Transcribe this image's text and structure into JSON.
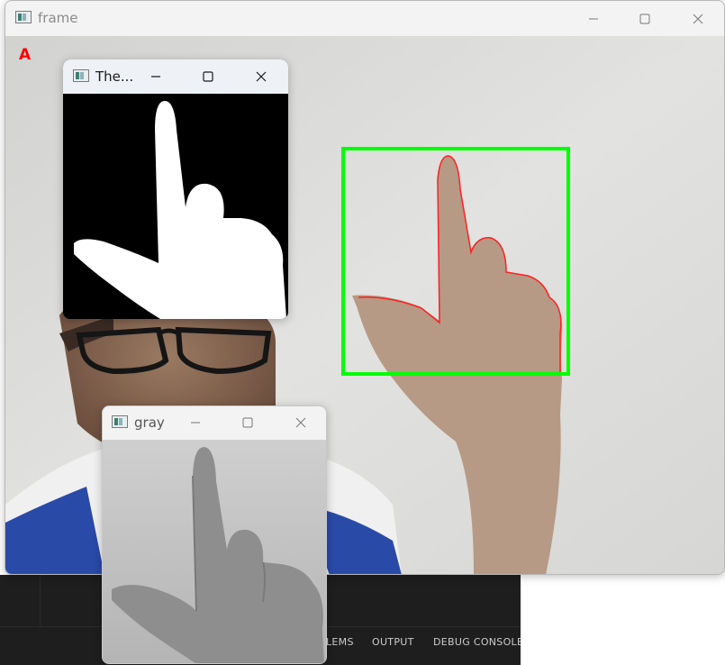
{
  "background_app": {
    "panel_tabs": [
      "PROBLEMS",
      "OUTPUT",
      "DEBUG CONSOLE"
    ],
    "problems_visible_fragment": "LEMS"
  },
  "windows": {
    "frame": {
      "title": "frame",
      "detected_letter": "A",
      "roi_box_color": "#00ff00",
      "contour_color": "#ff0000"
    },
    "thresh": {
      "title": "The..."
    },
    "gray": {
      "title": "gray"
    }
  },
  "icons": {
    "app": "opencv-window-icon",
    "minimize": "minimize-icon",
    "maximize": "maximize-icon",
    "close": "close-icon"
  }
}
